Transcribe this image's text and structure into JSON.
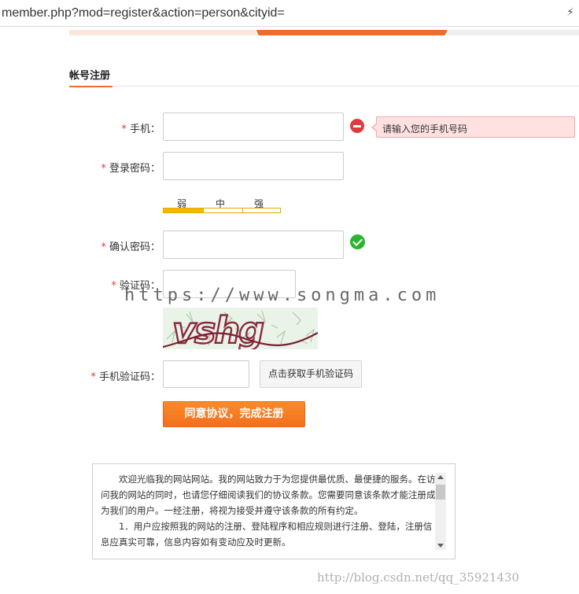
{
  "browser": {
    "url": "member.php?mod=register&action=person&cityid="
  },
  "tab": {
    "title": "帐号注册"
  },
  "form": {
    "required_mark": "*",
    "phone": {
      "label": "手机：",
      "value": ""
    },
    "phone_error": "请输入您的手机号码",
    "password": {
      "label": "登录密码：",
      "value": ""
    },
    "strength": {
      "weak": "弱",
      "medium": "中",
      "strong": "强",
      "level": 1
    },
    "confirm_password": {
      "label": "确认密码：",
      "value": ""
    },
    "captcha": {
      "label": "验证码：",
      "value": "",
      "image_text": "vshg"
    },
    "sms_code": {
      "label": "手机验证码：",
      "value": "",
      "button": "点击获取手机验证码"
    },
    "submit": "同意协议，完成注册"
  },
  "agreement": {
    "paragraphs": [
      "欢迎光临我的网站网站。我的网站致力于为您提供最优质、最便捷的服务。在访问我的网站的同时，也请您仔细阅读我们的协议条款。您需要同意该条款才能注册成为我们的用户。一经注册，将视为接受并遵守该条款的所有约定。",
      "1．用户应按照我的网站的注册、登陆程序和相应规则进行注册、登陆，注册信息应真实可靠，信息内容如有变动应及时更新。"
    ]
  },
  "watermarks": {
    "center": "https://www.songma.com",
    "corner": "http://blog.csdn.net/qq_35921430"
  },
  "colors": {
    "accent": "#ef6c2b",
    "required": "#e4393c",
    "error": "#e4393c",
    "success": "#2bb52f"
  }
}
